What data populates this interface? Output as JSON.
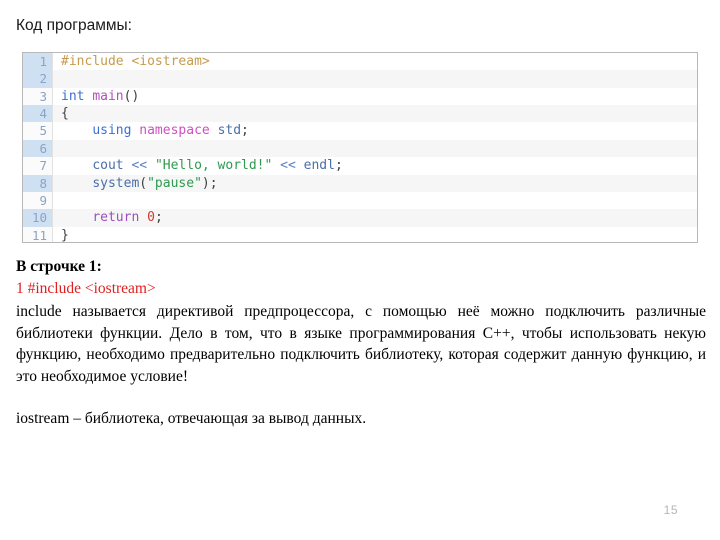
{
  "slide": {
    "title": "Код программы:",
    "page_number": "15"
  },
  "code": {
    "language": "cpp",
    "line_numbers": [
      "1",
      "2",
      "3",
      "4",
      "5",
      "6",
      "7",
      "8",
      "9",
      "10",
      "11"
    ],
    "lines": [
      {
        "n": "1",
        "text": "#include <iostream>"
      },
      {
        "n": "2",
        "text": ""
      },
      {
        "n": "3",
        "text": "int main()"
      },
      {
        "n": "4",
        "text": "{"
      },
      {
        "n": "5",
        "text": "    using namespace std;"
      },
      {
        "n": "6",
        "text": ""
      },
      {
        "n": "7",
        "text": "    cout << \"Hello, world!\" << endl;"
      },
      {
        "n": "8",
        "text": "    system(\"pause\");"
      },
      {
        "n": "9",
        "text": ""
      },
      {
        "n": "10",
        "text": "    return 0;"
      },
      {
        "n": "11",
        "text": "}"
      }
    ],
    "tokens": {
      "include_directive": "#include",
      "header": "<iostream>",
      "int": "int",
      "main": "main",
      "brace_open": "{",
      "brace_close": "}",
      "using": "using",
      "namespace": "namespace",
      "std": "std",
      "cout": "cout",
      "shift_op": "<<",
      "hello_string": "\"Hello, world!\"",
      "endl": "endl",
      "system": "system",
      "pause_string": "\"pause\"",
      "return": "return",
      "zero": "0",
      "semicolon": ";",
      "paren_open": "(",
      "paren_close": ")"
    },
    "colors": {
      "preprocessor": "#c79a4e",
      "keyword": "#3b6fd4",
      "function": "#b34fbd",
      "namespace": "#d14fc0",
      "string": "#2e9b4f",
      "number": "#d13b2e",
      "return_keyword": "#9b4fc0",
      "gutter_band": "#cfe0f2",
      "gutter_text": "#8aa4c4",
      "border": "#b8b8b8"
    }
  },
  "explanation": {
    "heading": "В строчке 1:",
    "code_reference": "1 #include <iostream>",
    "code_reference_color": "#e02020",
    "paragraph_1": "include называется директивой предпроцессора, с помощью неё можно подключить различные библиотеки функции. Дело в том, что в языке программирования C++, чтобы использовать некую функцию, необходимо предварительно подключить библиотеку, которая содержит данную функцию, и это необходимое условие!",
    "paragraph_2": "iostream – библиотека, отвечающая за вывод данных."
  }
}
